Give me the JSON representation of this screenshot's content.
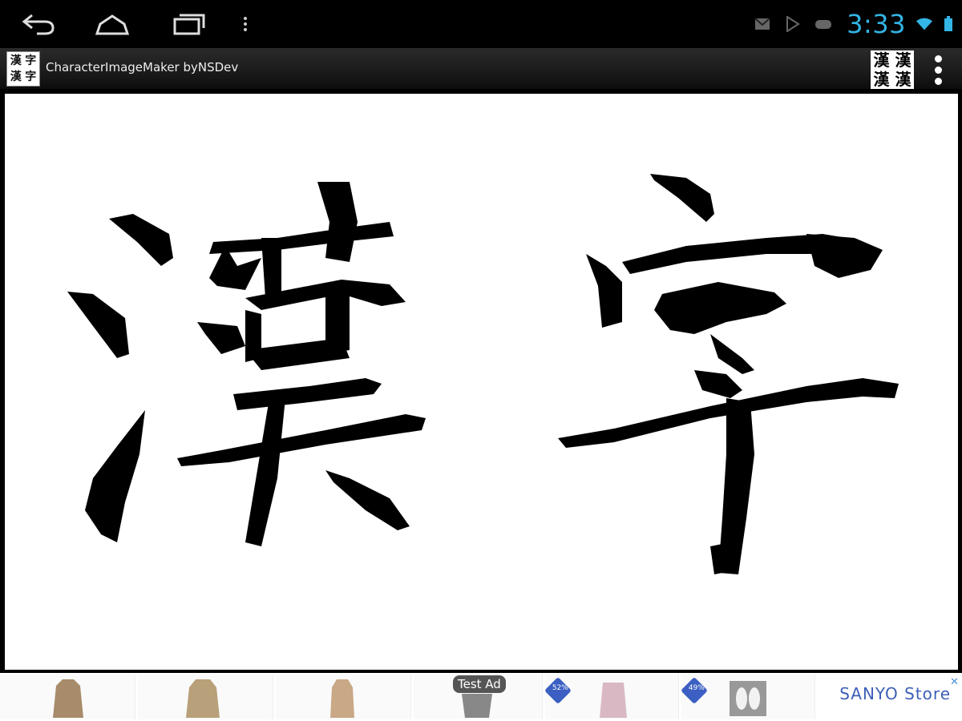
{
  "status_bar": {
    "clock": "3:33",
    "icons": [
      "gmail-icon",
      "play-store-icon",
      "game-controller-icon",
      "wifi-icon",
      "battery-icon"
    ],
    "accent_color": "#33b5e5"
  },
  "nav_bar": {
    "buttons": [
      "back-icon",
      "home-icon",
      "recent-apps-icon",
      "menu-icon"
    ]
  },
  "action_bar": {
    "title": "CharacterImageMaker byNSDev",
    "app_icon_chars": [
      "漢",
      "字",
      "漢",
      "字"
    ],
    "action_kanji": [
      "漢",
      "漢",
      "漢",
      "漢"
    ],
    "overflow_icon": "overflow-menu-icon"
  },
  "canvas": {
    "characters": "漢字",
    "background": "#ffffff",
    "ink_color": "#000000"
  },
  "ad_banner": {
    "label": "Test Ad",
    "brand": "SANYO Store",
    "close_icon": "ad-close-icon",
    "discounts": [
      "52%",
      "49%"
    ]
  }
}
